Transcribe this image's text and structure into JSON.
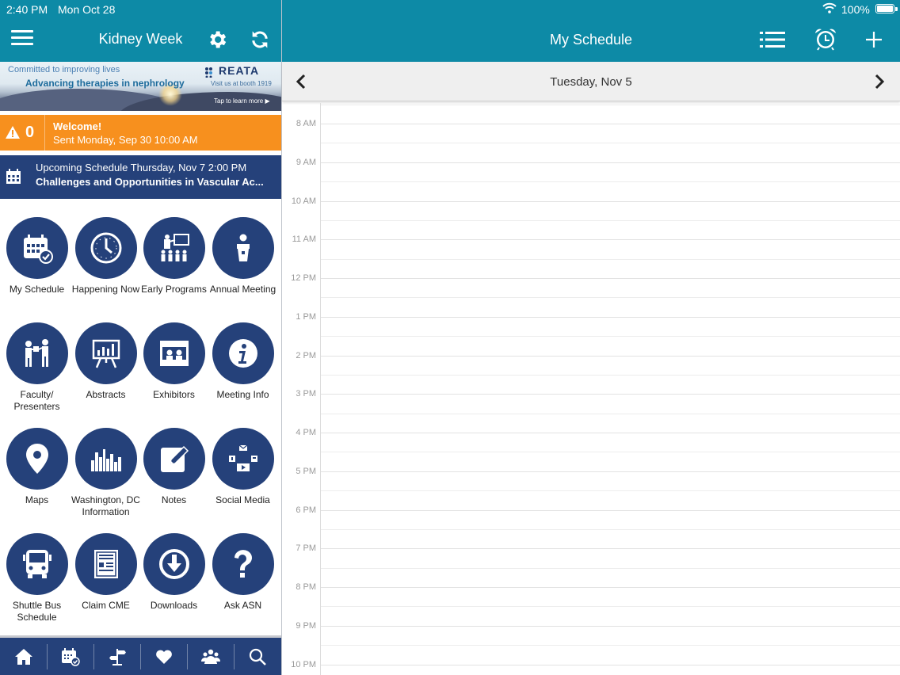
{
  "status": {
    "time": "2:40 PM",
    "date": "Mon Oct 28",
    "battery": "100%"
  },
  "left_nav": {
    "title": "Kidney Week"
  },
  "banner": {
    "line1": "Committed to improving lives",
    "line2": "Advancing therapies in nephrology",
    "brand": "REATA",
    "booth": "Visit us at booth 1919",
    "tap": "Tap to learn more"
  },
  "alert": {
    "count": "0",
    "title": "Welcome!",
    "sent": "Sent Monday, Sep 30 10:00 AM"
  },
  "upcoming": {
    "line1": "Upcoming Schedule Thursday, Nov 7 2:00 PM",
    "line2": "Challenges and Opportunities in Vascular Ac..."
  },
  "tiles": [
    {
      "label": "My Schedule",
      "icon": "calendar-check-icon"
    },
    {
      "label": "Happening Now",
      "icon": "clock-icon"
    },
    {
      "label": "Early Programs",
      "icon": "presentation-icon"
    },
    {
      "label": "Annual Meeting",
      "icon": "speaker-podium-icon"
    },
    {
      "label": "Faculty/ Presenters",
      "icon": "presenters-icon"
    },
    {
      "label": "Abstracts",
      "icon": "chart-board-icon"
    },
    {
      "label": "Exhibitors",
      "icon": "exhibitor-booth-icon"
    },
    {
      "label": "Meeting Info",
      "icon": "info-icon"
    },
    {
      "label": "Maps",
      "icon": "map-pin-icon"
    },
    {
      "label": "Washington, DC Information",
      "icon": "city-skyline-icon"
    },
    {
      "label": "Notes",
      "icon": "note-pencil-icon"
    },
    {
      "label": "Social Media",
      "icon": "social-media-icon"
    },
    {
      "label": "Shuttle Bus Schedule",
      "icon": "bus-icon"
    },
    {
      "label": "Claim CME",
      "icon": "certificate-icon"
    },
    {
      "label": "Downloads",
      "icon": "download-icon"
    },
    {
      "label": "Ask ASN",
      "icon": "question-icon"
    }
  ],
  "tabbar": [
    "home-icon",
    "calendar-check-icon",
    "signpost-icon",
    "heart-icon",
    "people-icon",
    "search-icon"
  ],
  "right_nav": {
    "title": "My Schedule"
  },
  "day": {
    "label": "Tuesday, Nov 5"
  },
  "hours": [
    "8 AM",
    "9 AM",
    "10 AM",
    "11 AM",
    "12 PM",
    "1 PM",
    "2 PM",
    "3 PM",
    "4 PM",
    "5 PM",
    "6 PM",
    "7 PM",
    "8 PM",
    "9 PM",
    "10 PM"
  ],
  "colors": {
    "teal": "#0d8aa6",
    "navy": "#25417a",
    "orange": "#f7901e"
  }
}
